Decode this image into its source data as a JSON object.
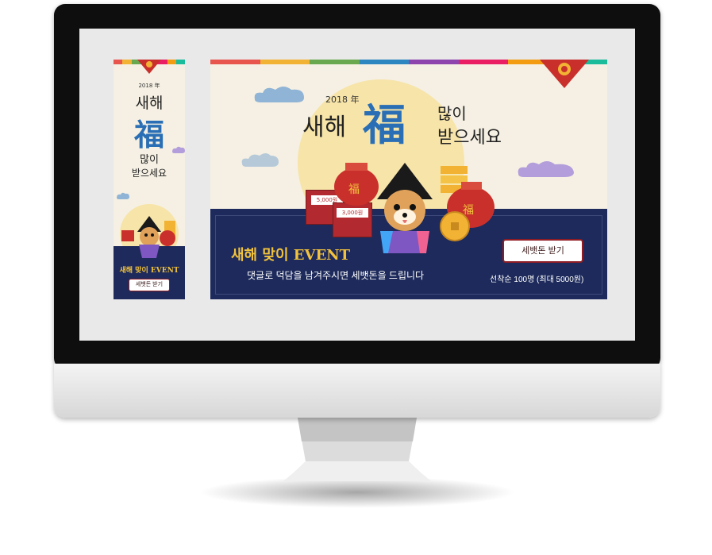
{
  "colors": {
    "navy": "#1d2a5b",
    "gold": "#f2c23c",
    "red": "#c9302c",
    "cream": "#f5f0e3",
    "moon": "#f7e4a9"
  },
  "stripe_colors": [
    "#e8554d",
    "#f2b233",
    "#6aa84f",
    "#2e86c1",
    "#8e44ad",
    "#e91e63",
    "#f39c12",
    "#1abc9c"
  ],
  "skyscraper": {
    "year": "2018 年",
    "title_line1": "새해",
    "fortune_char": "福",
    "title_line2": "많이",
    "title_line3": "받으세요",
    "event_title": "새해 맞이 EVENT",
    "button_label": "세뱃돈 받기"
  },
  "wide": {
    "year": "2018 年",
    "title_left": "새해",
    "fortune_char": "福",
    "title_right_1": "많이",
    "title_right_2": "받으세요",
    "envelope_1": "5,000원",
    "envelope_2": "3,000원",
    "event_title": "새해 맞이 EVENT",
    "event_desc": "댓글로 덕담을 남겨주시면 세뱃돈을 드립니다",
    "button_label": "세뱃돈 받기",
    "condition": "선착순 100명 (최대 5000원)"
  }
}
